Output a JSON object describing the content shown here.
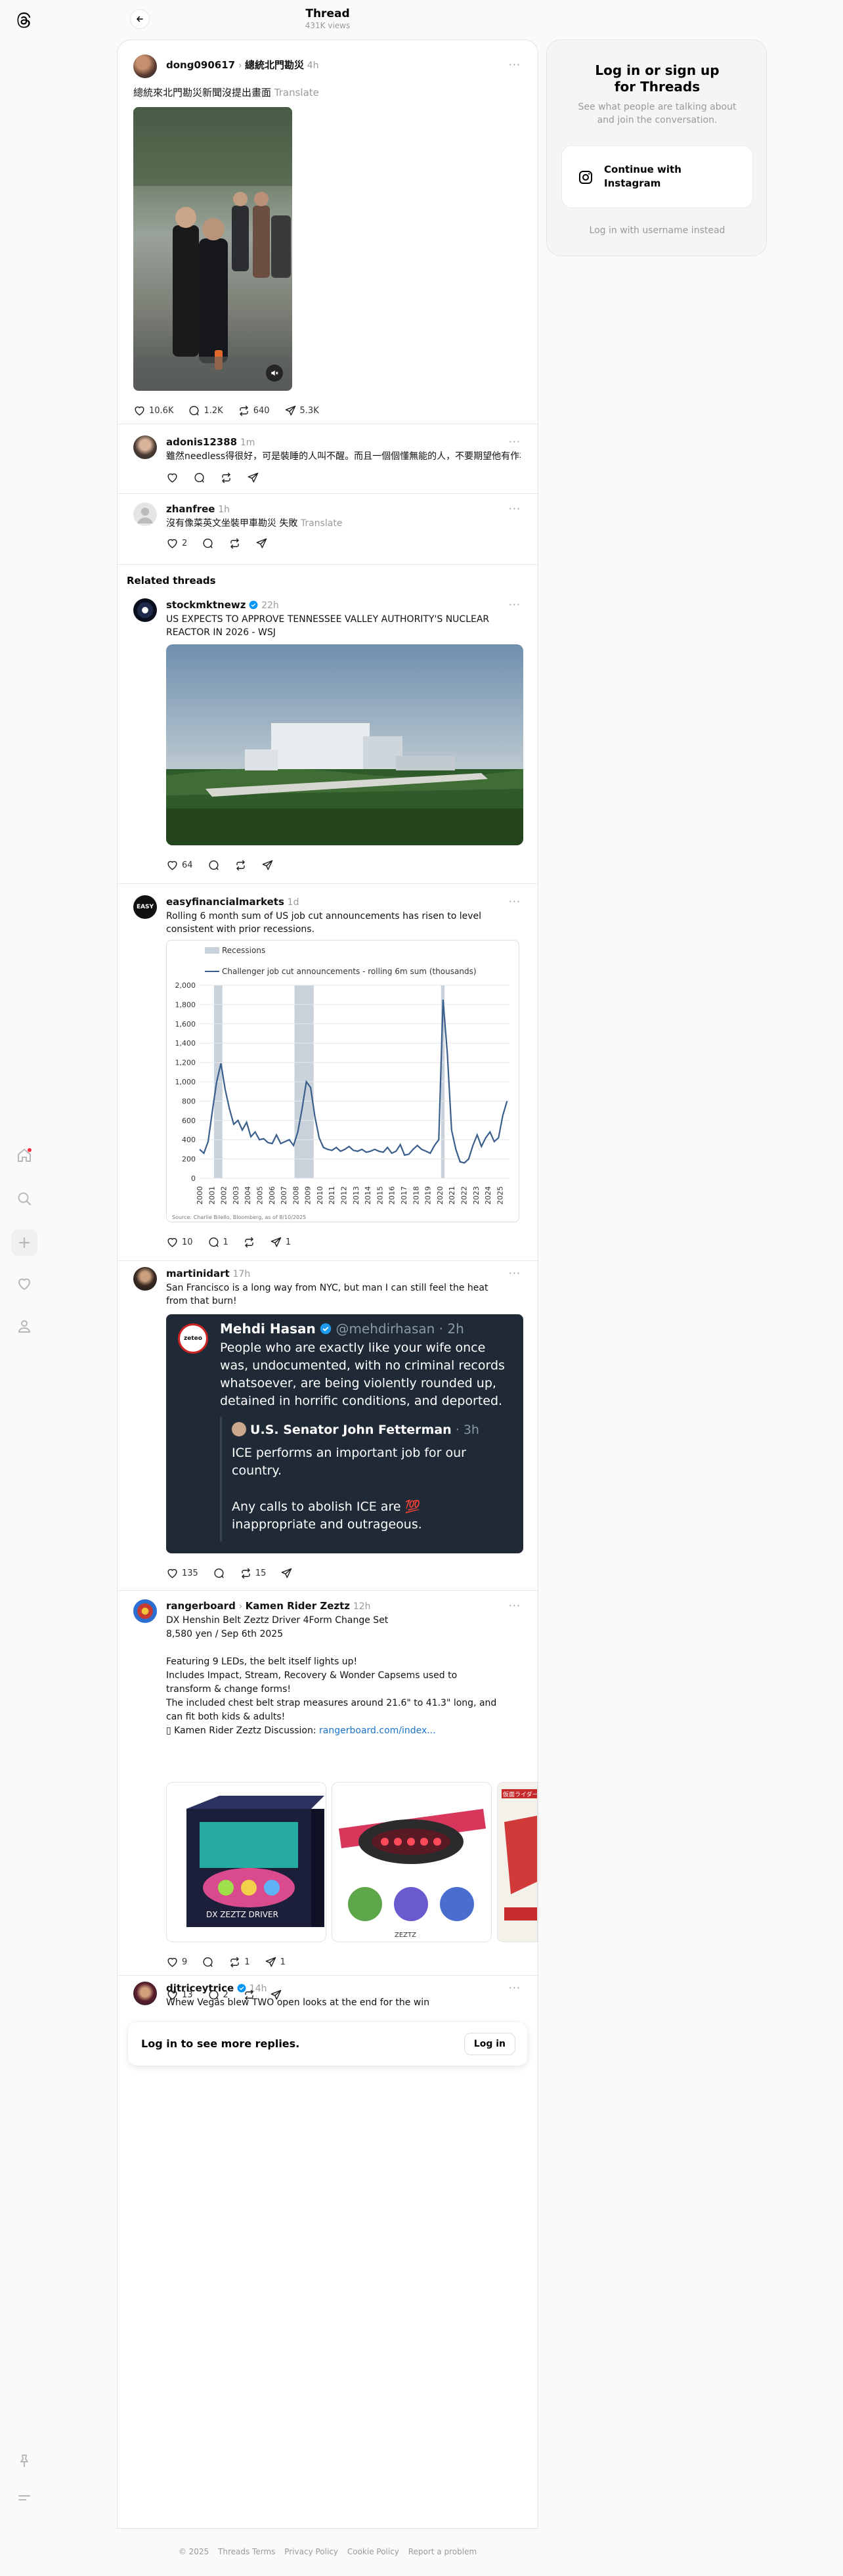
{
  "nav": {
    "icons": [
      "threads-logo-icon",
      "home-icon",
      "search-icon",
      "create-icon",
      "activity-icon",
      "profile-icon",
      "pin-icon",
      "menu-icon"
    ]
  },
  "header": {
    "title": "Thread",
    "views": "431K views"
  },
  "main_post": {
    "username": "dong090617",
    "topic": "總統北門勘災",
    "time": "4h",
    "text": "總統來北門勘災新聞沒提出畫面",
    "translate": "Translate",
    "likes": "10.6K",
    "replies": "1.2K",
    "reposts": "640",
    "shares": "5.3K"
  },
  "replies": [
    {
      "username": "adonis12388",
      "time": "1m",
      "text": "雖然needless得很好，可是裝睡的人叫不醒。而且一個個懂無能的人，不要期望他有作為"
    },
    {
      "username": "zhanfree",
      "time": "1h",
      "text": "沒有像菜英文坐裝甲車勘災 失敗",
      "translate": "Translate",
      "likes": "2"
    }
  ],
  "related": {
    "title": "Related threads",
    "posts": [
      {
        "username": "stockmktnewz",
        "time": "22h",
        "text_lines": [
          "US EXPECTS TO APPROVE TENNESSEE VALLEY AUTHORITY'S NUCLEAR",
          "REACTOR IN 2026 - WSJ"
        ],
        "likes": "64"
      },
      {
        "username": "easyfinancialmarkets",
        "time": "1d",
        "text_lines": [
          "Rolling 6 month sum of US job cut announcements has risen to level",
          "consistent with prior recessions."
        ],
        "likes": "10",
        "replies": "1",
        "shares": "1",
        "avatar_text": "EASY"
      },
      {
        "username": "martinidart",
        "time": "17h",
        "text_lines": [
          "San Francisco is a long way from NYC, but man I can still feel the heat",
          "from that burn!"
        ],
        "likes": "135",
        "reposts": "15"
      },
      {
        "username": "rangerboard",
        "topic": "Kamen Rider Zeztz",
        "time": "12h",
        "text_lines": [
          "DX Henshin Belt Zeztz Driver 4Form Change Set",
          "8,580 yen / Sep 6th 2025",
          "",
          "Featuring 9 LEDs, the belt itself lights up!",
          "Includes Impact, Stream, Recovery & Wonder Capsems used to",
          "transform & change forms!",
          "The included chest belt strap measures around 21.6\" to 41.3\" long, and",
          "can fit both kids & adults!"
        ],
        "discussion_prefix": "▯ Kamen Rider Zeztz Discussion: ",
        "discussion_link": "rangerboard.com/index...",
        "likes": "9",
        "reposts": "1",
        "shares": "1"
      },
      {
        "username": "djtriceytrice",
        "time": "14h",
        "text_lines": [
          "Whew Vegas blew TWO open looks at the end for the win"
        ],
        "likes": "13",
        "replies": "2"
      }
    ]
  },
  "chart_data": {
    "type": "line",
    "title": "",
    "legend": [
      "Recessions",
      "Challenger job cut announcements - rolling 6m sum (thousands)"
    ],
    "legend_placement": "top-left",
    "x": [
      "2000",
      "2001",
      "2002",
      "2003",
      "2004",
      "2005",
      "2006",
      "2007",
      "2008",
      "2009",
      "2010",
      "2011",
      "2012",
      "2013",
      "2014",
      "2015",
      "2016",
      "2017",
      "2018",
      "2019",
      "2020",
      "2021",
      "2022",
      "2023",
      "2024",
      "2025"
    ],
    "ylim": [
      0,
      2000
    ],
    "yticks": [
      "0",
      "200",
      "400",
      "600",
      "800",
      "1,000",
      "1,200",
      "1,400",
      "1,600",
      "1,800",
      "2,000"
    ],
    "recessions": [
      [
        2001.2,
        2001.9
      ],
      [
        2007.9,
        2009.5
      ],
      [
        2020.1,
        2020.4
      ]
    ],
    "series": [
      {
        "name": "Challenger job cut announcements - rolling 6m sum (thousands)",
        "values": [
          300,
          260,
          380,
          700,
          1000,
          1190,
          920,
          720,
          560,
          600,
          500,
          580,
          430,
          480,
          400,
          410,
          370,
          360,
          450,
          360,
          380,
          400,
          340,
          480,
          720,
          1000,
          940,
          640,
          420,
          320,
          300,
          290,
          320,
          280,
          300,
          330,
          290,
          280,
          300,
          270,
          280,
          300,
          280,
          270,
          320,
          260,
          280,
          350,
          240,
          250,
          300,
          340,
          300,
          280,
          260,
          340,
          400,
          1850,
          1300,
          500,
          300,
          170,
          160,
          200,
          340,
          450,
          330,
          420,
          480,
          380,
          420,
          650,
          800
        ],
        "x_start": 2000.0,
        "x_end": 2025.6
      }
    ],
    "source": "Source: Charlie Bilello, Bloomberg, as of 8/10/2025"
  },
  "embedded_tweet": {
    "name": "Mehdi Hasan",
    "handle": "@mehdirhasan · 2h",
    "avatar_text": "zeteo",
    "text": "People who are exactly like your wife once was, undocumented, with no criminal records whatsoever, are being violently rounded up, detained in horrific conditions, and deported.",
    "quoted_name": "U.S. Senator John Fetterman",
    "quoted_time": "· 3h",
    "quoted_text_1": "ICE performs an important job for our country.",
    "quoted_text_2": "Any calls to abolish ICE are 💯 inappropriate and outrageous."
  },
  "product_images": [
    "DX ZEZTZ DRIVER",
    "ZEZTZ",
    "仮面ライダーゼッツ"
  ],
  "login_prompt": {
    "text": "Log in to see more replies.",
    "button": "Log in"
  },
  "login_card": {
    "title_line1": "Log in or sign up",
    "title_line2": "for Threads",
    "subtitle_line1": "See what people are talking about",
    "subtitle_line2": "and join the conversation.",
    "instagram_line1": "Continue with",
    "instagram_line2": "Instagram",
    "alt_login": "Log in with username instead"
  },
  "footer": {
    "copyright": "© 2025",
    "links": [
      "Threads Terms",
      "Privacy Policy",
      "Cookie Policy",
      "Report a problem"
    ]
  },
  "colors": {
    "accent_blue": "#1d73c9",
    "verified_blue": "#0095f6",
    "notification_red": "#ff3040",
    "tweet_bg": "#15202b"
  }
}
